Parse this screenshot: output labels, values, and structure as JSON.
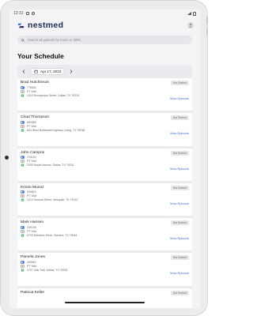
{
  "status_bar": {
    "time": "12:31"
  },
  "header": {
    "app_name": "nestmed"
  },
  "search": {
    "placeholder": "Search all patients by name or MRN"
  },
  "page": {
    "title": "Your Schedule"
  },
  "schedule": {
    "date": "Apr 17, 2023"
  },
  "visits": [
    {
      "name": "Brad Hutchinson",
      "mrn": "776632",
      "visit_type": "PT Visit",
      "address": "1310 Sunnyslope Street, Dallas, TX 75224",
      "status": "Not Started",
      "action": "View Episode"
    },
    {
      "name": "Chad Thompson",
      "mrn": "889483",
      "visit_type": "PT Visit",
      "address": "803 West Northwest Highway, Irving, TX 75038",
      "status": "Not Started",
      "action": "View Episode"
    },
    {
      "name": "John Campos",
      "mrn": "729154",
      "visit_type": "PT Visit",
      "address": "2005 Maple Avenue, Dallas, TX 75201",
      "status": "Not Started",
      "action": "View Episode"
    },
    {
      "name": "Kristin Munoz",
      "mrn": "339824",
      "visit_type": "PT Visit",
      "address": "1212 Ventura Street, Mesquite, TX 75149",
      "status": "Not Started",
      "action": "View Episode"
    },
    {
      "name": "Mark Hansen",
      "mrn": "239195",
      "visit_type": "PT Visit",
      "address": "6703 Eastview Drive, Garland, TX 75044",
      "status": "Not Started",
      "action": "View Episode"
    },
    {
      "name": "Pamela Jones",
      "mrn": "449661",
      "visit_type": "PT Visit",
      "address": "4707 Oak Trail, Dallas, TX 75252",
      "status": "Not Started",
      "action": "View Episode"
    },
    {
      "name": "Patricia Keller",
      "status": "Not Started"
    }
  ],
  "colors": {
    "accent": "#3c6fd6",
    "brand": "#1f2a55",
    "icon_green": "#49b36c"
  }
}
